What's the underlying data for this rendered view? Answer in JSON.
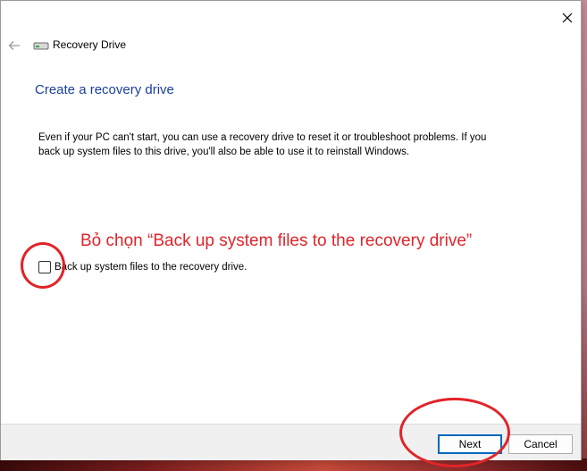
{
  "window": {
    "title": "Recovery Drive",
    "heading": "Create a recovery drive",
    "description": "Even if your PC can't start, you can use a recovery drive to reset it or troubleshoot problems. If you back up system files to this drive, you'll also be able to use it to reinstall Windows.",
    "checkbox": {
      "label": "Back up system files to the recovery drive.",
      "checked": false
    },
    "buttons": {
      "next": "Next",
      "cancel": "Cancel"
    }
  },
  "annotation": {
    "text": "Bỏ chọn “Back up system files to the recovery drive”",
    "color": "#e0242a"
  },
  "icons": {
    "close": "close-icon",
    "back": "back-arrow-icon",
    "app": "drive-icon"
  },
  "colors": {
    "heading": "#1a3fa0",
    "accent": "#0067c0"
  }
}
